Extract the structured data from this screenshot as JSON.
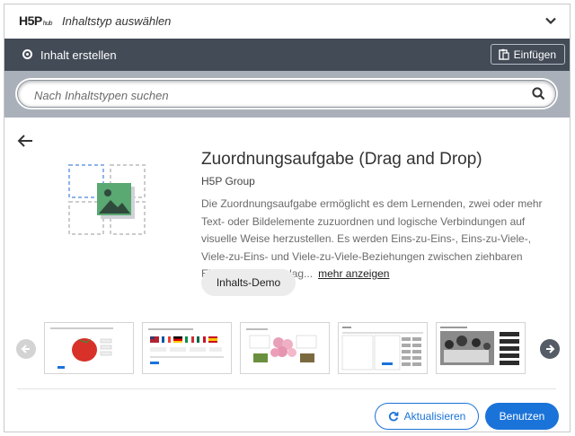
{
  "header": {
    "logo_text": "H5P",
    "logo_sub": "hub",
    "title": "Inhaltstyp auswählen",
    "collapse_icon": "chevron-down-icon"
  },
  "tabs": {
    "create_label": "Inhalt erstellen",
    "paste_label": "Einfügen"
  },
  "search": {
    "placeholder": "Nach Inhaltstypen suchen",
    "value": ""
  },
  "detail": {
    "title": "Zuordnungsaufgabe (Drag and Drop)",
    "owner": "H5P Group",
    "description": "Die Zuordnungsaufgabe ermöglicht es dem Lernenden, zwei oder mehr Text- oder Bildelemente zuzuordnen und logische Verbindungen auf visuelle Weise herzustellen. Es werden Eins-zu-Eins-, Eins-zu-Viele-, Viele-zu-Eins- und Viele-zu-Viele-Beziehungen zwischen ziehbaren Elementen und Ablag...",
    "more_label": "mehr anzeigen",
    "demo_label": "Inhalts-Demo",
    "screenshots": [
      "screenshot-strawberry",
      "screenshot-flags",
      "screenshot-flowers",
      "screenshot-table",
      "screenshot-photo"
    ]
  },
  "footer": {
    "update_label": "Aktualisieren",
    "use_label": "Benutzen"
  },
  "colors": {
    "accent": "#1a73d9",
    "tabbar": "#434b57",
    "searchbar": "#a9b0ba"
  }
}
